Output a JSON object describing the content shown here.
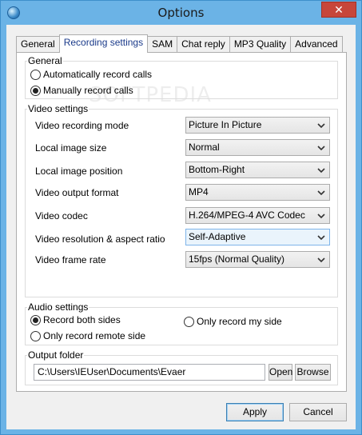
{
  "window": {
    "title": "Options",
    "close_symbol": "✕"
  },
  "tabs": [
    {
      "label": "General"
    },
    {
      "label": "Recording settings"
    },
    {
      "label": "SAM"
    },
    {
      "label": "Chat reply"
    },
    {
      "label": "MP3 Quality"
    },
    {
      "label": "Advanced"
    }
  ],
  "active_tab": "Recording settings",
  "watermark": "SOFTPEDIA",
  "general": {
    "title": "General",
    "auto_record_label": "Automatically record calls",
    "manual_record_label": "Manually record calls",
    "selected": "manual"
  },
  "video": {
    "title": "Video settings",
    "settings": [
      {
        "label": "Video recording mode",
        "value": "Picture In Picture"
      },
      {
        "label": "Local image size",
        "value": "Normal"
      },
      {
        "label": "Local image position",
        "value": "Bottom-Right"
      },
      {
        "label": "Video output format",
        "value": "MP4"
      },
      {
        "label": "Video codec",
        "value": "H.264/MPEG-4 AVC Codec"
      },
      {
        "label": "Video resolution & aspect ratio",
        "value": "Self-Adaptive"
      },
      {
        "label": "Video frame rate",
        "value": "15fps (Normal Quality)"
      }
    ]
  },
  "audio": {
    "title": "Audio settings",
    "both_sides_label": "Record both sides",
    "my_side_label": "Only record my side",
    "remote_side_label": "Only record remote side",
    "selected": "both"
  },
  "output": {
    "title": "Output folder",
    "path": "C:\\Users\\IEUser\\Documents\\Evaer",
    "open_label": "Open",
    "browse_label": "Browse"
  },
  "footer": {
    "apply_label": "Apply",
    "cancel_label": "Cancel"
  },
  "icons": {
    "app": "globe-icon",
    "dropdown": "chevron-down-icon"
  }
}
